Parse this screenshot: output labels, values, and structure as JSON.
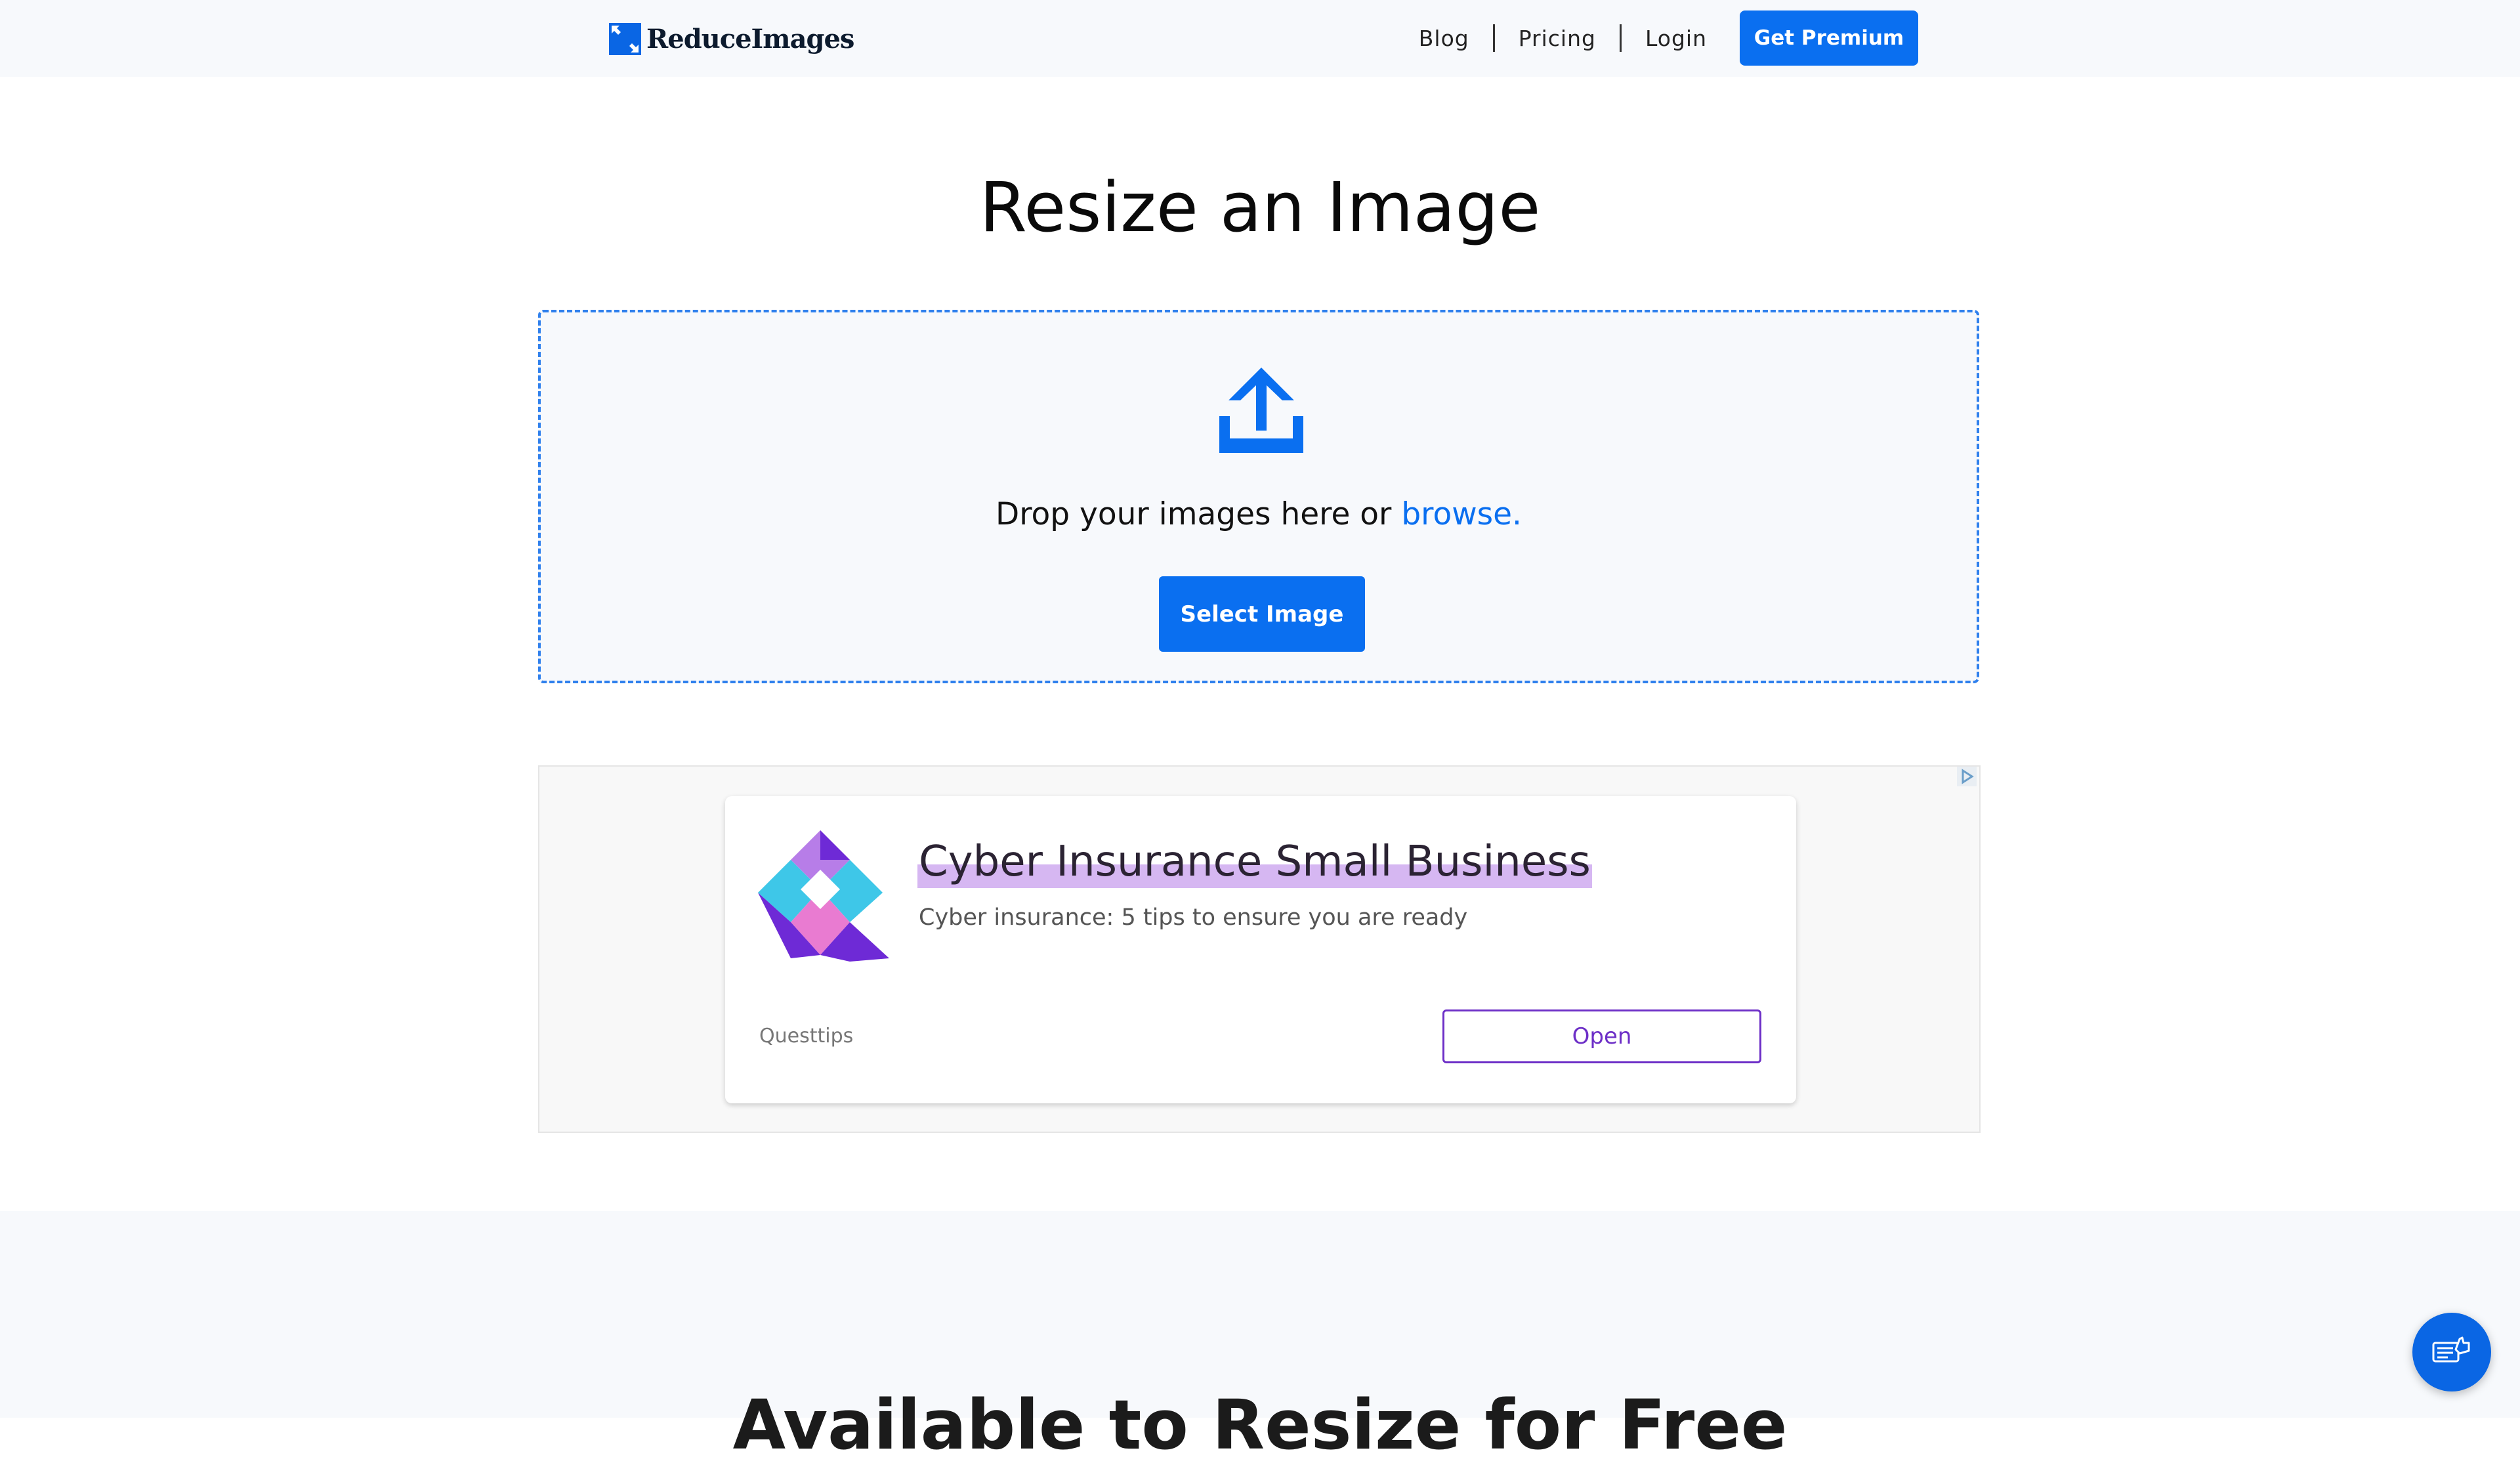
{
  "header": {
    "logo_text": "ReduceImages",
    "nav": [
      "Blog",
      "Pricing",
      "Login"
    ],
    "premium_label": "Get Premium"
  },
  "main": {
    "title": "Resize an Image",
    "drop_text": "Drop your images here or ",
    "browse_label": "browse.",
    "select_label": "Select Image"
  },
  "ad": {
    "headline": "Cyber Insurance Small Business",
    "description": "Cyber insurance: 5 tips to ensure you are ready",
    "advertiser": "Questtips",
    "cta_label": "Open"
  },
  "bottom": {
    "heading_partial": "Available to Resize for Free"
  },
  "icons": [
    "upload-icon",
    "ad-choices-icon",
    "feedback-icon"
  ],
  "colors": {
    "accent": "#0a6ff0",
    "ad_accent": "#6d2fc7",
    "header_bg": "#f7f9fc"
  }
}
